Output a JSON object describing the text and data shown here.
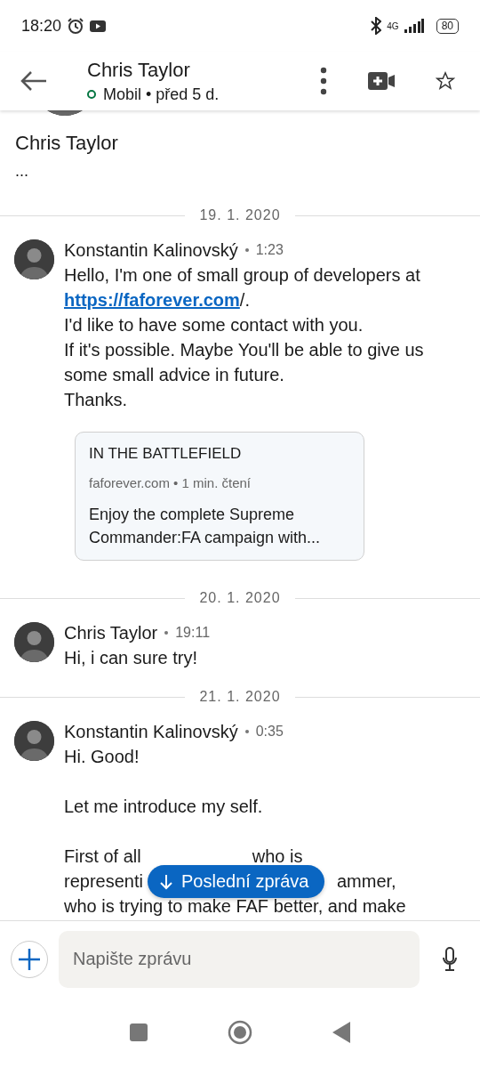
{
  "status_bar": {
    "time": "18:20",
    "network": "4G",
    "battery": "80"
  },
  "header": {
    "title": "Chris Taylor",
    "online": true,
    "subtitle": "Mobil • před 5 d."
  },
  "profile": {
    "name": "Chris Taylor",
    "headline": "..."
  },
  "days": [
    {
      "date": "19. 1. 2020",
      "messages": [
        {
          "sender": "Konstantin Kalinovský",
          "time": "1:23",
          "paragraphs": [
            [
              [
                {
                  "kind": "text",
                  "text": "Hello, I'm one of small group of developers at "
                },
                {
                  "kind": "link",
                  "text": "https://faforever.com"
                },
                {
                  "kind": "text",
                  "text": "/."
                }
              ],
              [
                {
                  "kind": "text",
                  "text": "I'd like to have some contact with you."
                }
              ],
              [
                {
                  "kind": "text",
                  "text": "If it's possible. Maybe You'll be able to give us some small advice in future."
                }
              ],
              [
                {
                  "kind": "text",
                  "text": "Thanks."
                }
              ]
            ]
          ],
          "link_preview": {
            "title": "IN THE BATTLEFIELD",
            "meta": "faforever.com • 1 min. čtení",
            "description": "Enjoy the complete Supreme Commander:FA campaign with..."
          }
        }
      ]
    },
    {
      "date": "20. 1. 2020",
      "messages": [
        {
          "sender": "Chris Taylor",
          "time": "19:11",
          "paragraphs": [
            [
              [
                {
                  "kind": "text",
                  "text": "Hi, i can sure try!"
                }
              ]
            ]
          ]
        }
      ]
    },
    {
      "date": "21. 1. 2020",
      "messages": [
        {
          "sender": "Konstantin Kalinovský",
          "time": "0:35",
          "paragraphs": [
            [
              [
                {
                  "kind": "text",
                  "text": "Hi. Good!"
                }
              ]
            ],
            [
              [
                {
                  "kind": "text",
                  "text": "Let me introduce my self."
                }
              ]
            ]
          ],
          "covered_lines": [
            {
              "left": "First of all",
              "right": "who is"
            },
            {
              "left": "representi",
              "right": "ammer,"
            },
            {
              "left": "who is trying to make FAF better, and make"
            }
          ]
        }
      ]
    }
  ],
  "jump_button": {
    "label": "Poslední zpráva"
  },
  "composer": {
    "placeholder": "Napište zprávu"
  }
}
